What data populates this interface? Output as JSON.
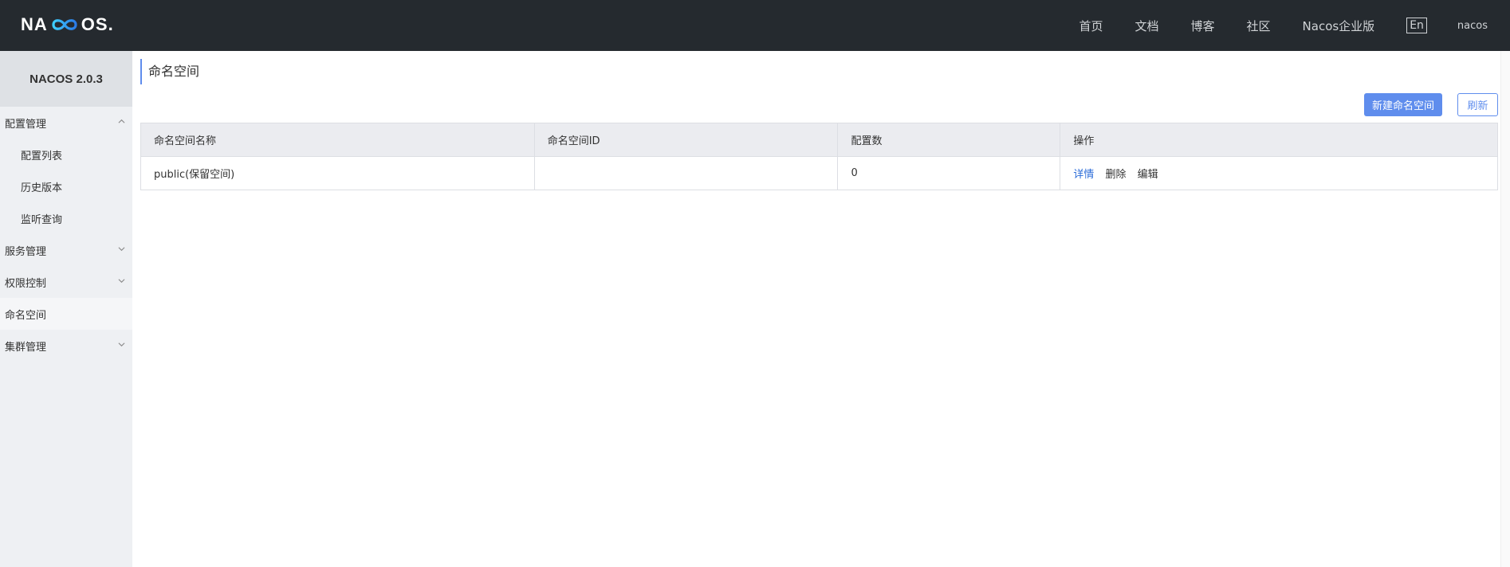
{
  "header": {
    "logo_text_left": "NA",
    "logo_text_right": "OS",
    "logo_dot": ".",
    "nav": [
      "首页",
      "文档",
      "博客",
      "社区",
      "Nacos企业版"
    ],
    "lang_button": "En",
    "user": "nacos"
  },
  "sidebar": {
    "version": "NACOS 2.0.3",
    "items": [
      {
        "label": "配置管理",
        "expanded": true
      },
      {
        "label": "配置列表"
      },
      {
        "label": "历史版本"
      },
      {
        "label": "监听查询"
      },
      {
        "label": "服务管理",
        "expanded": false
      },
      {
        "label": "权限控制",
        "expanded": false
      },
      {
        "label": "命名空间",
        "active": true
      },
      {
        "label": "集群管理",
        "expanded": false
      }
    ]
  },
  "main": {
    "title": "命名空间",
    "create_button": "新建命名空间",
    "refresh_button": "刷新",
    "table": {
      "columns": [
        "命名空间名称",
        "命名空间ID",
        "配置数",
        "操作"
      ],
      "rows": [
        {
          "name": "public(保留空间)",
          "id": "",
          "config_count": "0",
          "actions": [
            "详情",
            "删除",
            "编辑"
          ]
        }
      ]
    }
  },
  "colors": {
    "header_bg": "#252a2f",
    "sidebar_bg": "#eef0f3",
    "accent": "#5f8ded",
    "link": "#2b6cd8"
  }
}
